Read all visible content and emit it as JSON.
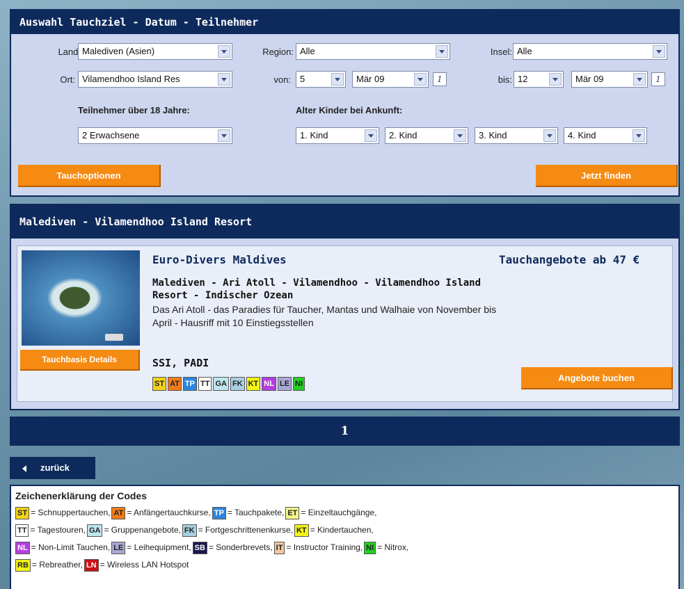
{
  "search": {
    "title": "Auswahl Tauchziel - Datum - Teilnehmer",
    "land_label": "Land:",
    "land_value": "Malediven (Asien)",
    "region_label": "Region:",
    "region_value": "Alle",
    "insel_label": "Insel:",
    "insel_value": "Alle",
    "ort_label": "Ort:",
    "ort_value": "Vilamendhoo Island Res",
    "von_label": "von:",
    "von_day": "5",
    "von_month": "Mär 09",
    "bis_label": "bis:",
    "bis_day": "12",
    "bis_month": "Mär 09",
    "calendar_glyph": "1",
    "adults_heading": "Teilnehmer über 18 Jahre:",
    "adults_value": "2 Erwachsene",
    "kids_heading": "Alter Kinder bei Ankunft:",
    "kids": [
      "1. Kind",
      "2. Kind",
      "3. Kind",
      "4. Kind"
    ],
    "dive_options_button": "Tauchoptionen",
    "find_button": "Jetzt finden"
  },
  "result": {
    "title": "Malediven - Vilamendhoo Island Resort",
    "center_name": "Euro-Divers Maldives",
    "price_text": "Tauchangebote ab 47 €",
    "location_line1": "Malediven - Ari Atoll - Vilamendhoo - Vilamendhoo Island",
    "location_line2": "Resort - Indischer Ozean",
    "description_line1": "Das Ari Atoll - das Paradies für Taucher, Mantas und Walhaie von November bis",
    "description_line2": "April - Hausriff mit 10 Einstiegsstellen",
    "certifications": "SSI, PADI",
    "details_button": "Tauchbasis Details",
    "book_button": "Angebote buchen",
    "codes": [
      {
        "code": "ST",
        "color": "#f2d21b"
      },
      {
        "code": "AT",
        "color": "#f07c1a"
      },
      {
        "code": "TP",
        "color": "#2d86e0"
      },
      {
        "code": "TT",
        "color": "#ffffff"
      },
      {
        "code": "GA",
        "color": "#bfe6ef"
      },
      {
        "code": "FK",
        "color": "#a8cfe0"
      },
      {
        "code": "KT",
        "color": "#f5f514"
      },
      {
        "code": "NL",
        "color": "#b43ee0"
      },
      {
        "code": "LE",
        "color": "#a9a9d6"
      },
      {
        "code": "NI",
        "color": "#22d022"
      }
    ]
  },
  "pager": {
    "page": "1"
  },
  "back_button": "zurück",
  "legend": {
    "title": "Zeichenerklärung der Codes",
    "lines": [
      [
        {
          "code": "ST",
          "color": "#f2d21b",
          "text": "= Schnuppertauchen,"
        },
        {
          "code": "AT",
          "color": "#f07c1a",
          "text": "= Anfängertauchkurse,"
        },
        {
          "code": "TP",
          "color": "#2d86e0",
          "text": "= Tauchpakete,"
        },
        {
          "code": "ET",
          "color": "#f5f58a",
          "text": "= Einzeltauchgänge,"
        }
      ],
      [
        {
          "code": "TT",
          "color": "#ffffff",
          "text": "= Tagestouren,"
        },
        {
          "code": "GA",
          "color": "#bfe6ef",
          "text": "= Gruppenangebote,"
        },
        {
          "code": "FK",
          "color": "#a8cfe0",
          "text": "= Fortgeschrittenenkurse,"
        },
        {
          "code": "KT",
          "color": "#f5f514",
          "text": "= Kindertauchen,"
        }
      ],
      [
        {
          "code": "NL",
          "color": "#b43ee0",
          "text": "= Non-Limit Tauchen,"
        },
        {
          "code": "LE",
          "color": "#a9a9d6",
          "text": "= Leihequipment,"
        },
        {
          "code": "SB",
          "color": "#1a1a4d",
          "text": "= Sonderbrevets,"
        },
        {
          "code": "IT",
          "color": "#f5c7a0",
          "text": "= Instructor Training,"
        },
        {
          "code": "NI",
          "color": "#22d022",
          "text": "= Nitrox,"
        }
      ],
      [
        {
          "code": "RB",
          "color": "#f5f514",
          "text": "= Rebreather,"
        },
        {
          "code": "LN",
          "color": "#cc1111",
          "text": "= Wireless LAN Hotspot"
        }
      ]
    ]
  }
}
